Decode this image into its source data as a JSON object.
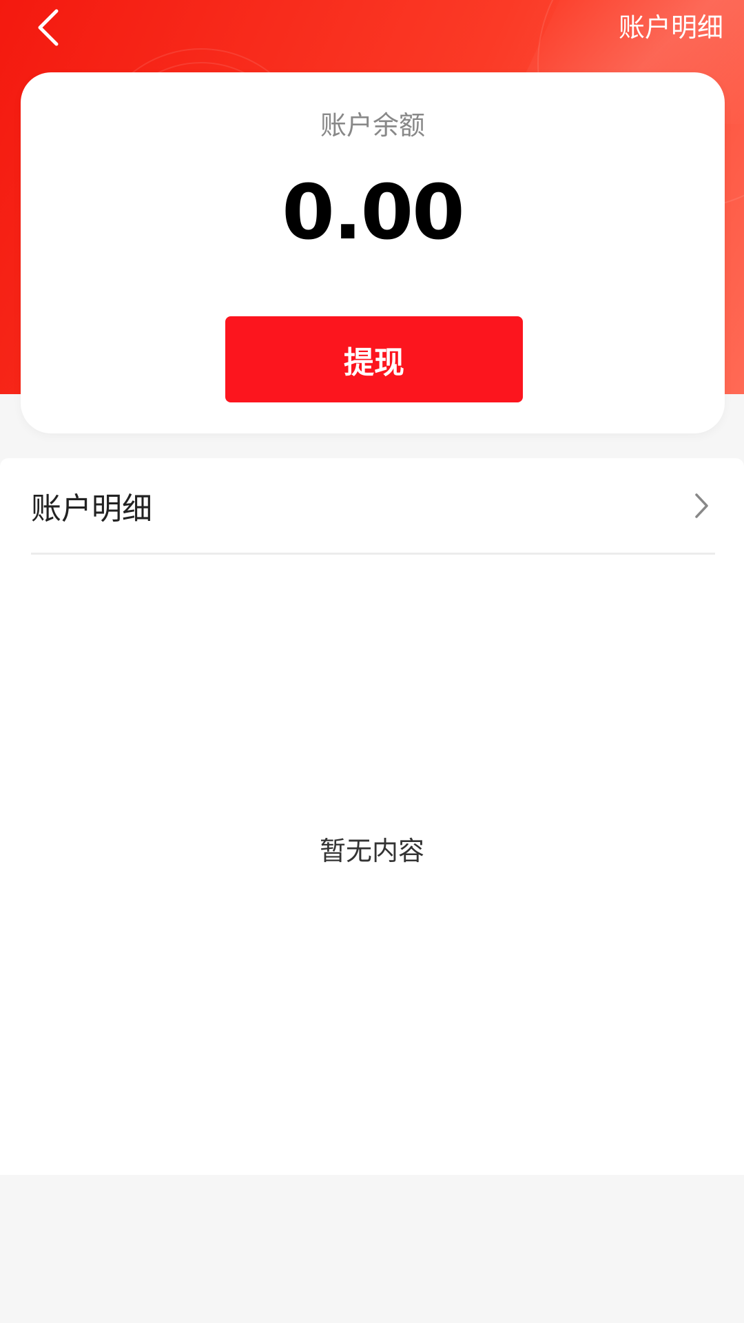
{
  "header": {
    "back_icon": "chevron-left-icon",
    "top_link_label": "账户明细",
    "background_colors": [
      "#f4190f",
      "#ff6a55"
    ]
  },
  "balance_card": {
    "label": "账户余额",
    "amount": "0.00",
    "withdraw_label": "提现",
    "withdraw_color": "#fc151e"
  },
  "details": {
    "row_title": "账户明细",
    "row_icon": "chevron-right-icon",
    "empty_text": "暂无内容"
  }
}
